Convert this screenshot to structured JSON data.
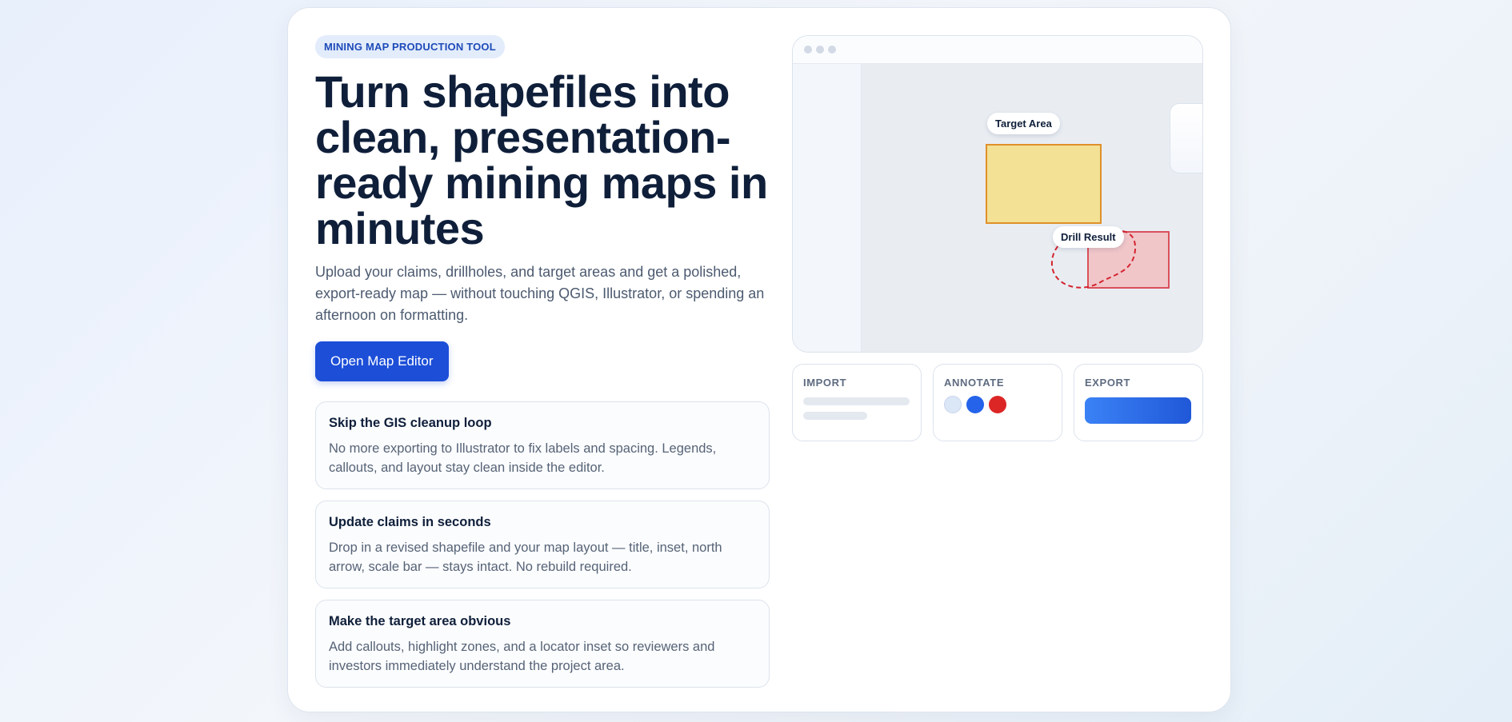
{
  "hero": {
    "badge": "MINING MAP PRODUCTION TOOL",
    "headline": "Turn shapefiles into clean, presentation-ready mining maps in minutes",
    "subtext": "Upload your claims, drillholes, and target areas and get a polished, export-ready map — without touching QGIS, Illustrator, or spending an afternoon on formatting.",
    "cta_label": "Open Map Editor"
  },
  "features": [
    {
      "title": "Skip the GIS cleanup loop",
      "body": "No more exporting to Illustrator to fix labels and spacing. Legends, callouts, and layout stay clean inside the editor."
    },
    {
      "title": "Update claims in seconds",
      "body": "Drop in a revised shapefile and your map layout — title, inset, north arrow, scale bar — stays intact. No rebuild required."
    },
    {
      "title": "Make the target area obvious",
      "body": "Add callouts, highlight zones, and a locator inset so reviewers and investors immediately understand the project area."
    }
  ],
  "preview": {
    "target_label": "Target Area",
    "drill_label": "Drill Result"
  },
  "steps": {
    "import_label": "IMPORT",
    "annotate_label": "ANNOTATE",
    "export_label": "EXPORT"
  },
  "colors": {
    "accent": "#1c4ed8",
    "target_fill": "#f3e196",
    "target_stroke": "#e0902a",
    "drill_fill": "#f0c6c9",
    "drill_stroke": "#d9505a",
    "swatches": [
      "#dbe6f7",
      "#2563eb",
      "#dc2626"
    ]
  }
}
